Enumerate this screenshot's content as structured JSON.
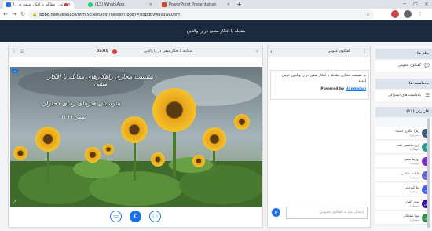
{
  "browser": {
    "tabs": [
      {
        "label": "همایش ملی - مقابله با افکار منفی در را...",
        "active": true,
        "icon": "recording-tab-icon",
        "color": "#1a73e8"
      },
      {
        "label": "(13) WhatsApp",
        "active": false,
        "icon": "whatsapp-icon",
        "color": "#25d366"
      },
      {
        "label": "PowerPoint Presentation",
        "active": false,
        "icon": "powerpoint-icon",
        "color": "#d24726"
      }
    ],
    "url": "bbb8.hamkelasi.co/html5client/join?sessionToken=lsgpdbvwuv3wa0bnf",
    "new_tab_glyph": "+"
  },
  "header": {
    "title": "مقابله با افکار منفی در را والدین"
  },
  "video": {
    "title": "مقابله با افکار منفی در را والدین",
    "timer": "03:01",
    "image_text_line1": "نشست مجازی راهکارهای مقابله با افکار منفی",
    "image_text_line2": "هنرستان هنرهای زیبای دختران",
    "image_text_line3": "بهمن ۱۳۹۹"
  },
  "chat": {
    "title": "گفتگوی عمومی",
    "welcome": "به نشست مجازی مقابله با افکار منفی در را والدین خوش آمدید",
    "powered_prefix": "Powered by",
    "powered_link": "Hamkelasi",
    "input_placeholder": "ارسال پیام به گفتگوی عمومی"
  },
  "sidebar": {
    "messages_title": "پیام ها",
    "public_chat": "گفتگوی عمومی",
    "notes_title": "یادداشت ها",
    "shared_notes": "یادداشت های اشتراکی",
    "users_title": "کاربران (12)",
    "users": [
      {
        "initials": "ز",
        "name": "زهرا انگاری (شما)",
        "role": "(مدرس)",
        "color": "#3d5a80"
      },
      {
        "initials": "ا",
        "name": "اریخ هاشمی ثابت",
        "role": "(مهمان)",
        "color": "#2a9d8f"
      },
      {
        "initials": "ر",
        "name": "روژینا نجفی",
        "role": "(مهمان)",
        "color": "#7b2cbf"
      },
      {
        "initials": "ف",
        "name": "فاطمه صاحبی",
        "role": "(مهمان)",
        "color": "#5e60ce"
      },
      {
        "initials": "ن",
        "name": "نیلا کیوخانی",
        "role": "(مهمان)",
        "color": "#4361ee"
      },
      {
        "initials": "س",
        "name": "سحر آلمان",
        "role": "(مهمان)",
        "color": "#3a0ca3"
      },
      {
        "initials": "م",
        "name": "مونا سلطان",
        "role": "(مهمان)",
        "color": "#2b9348"
      }
    ]
  }
}
